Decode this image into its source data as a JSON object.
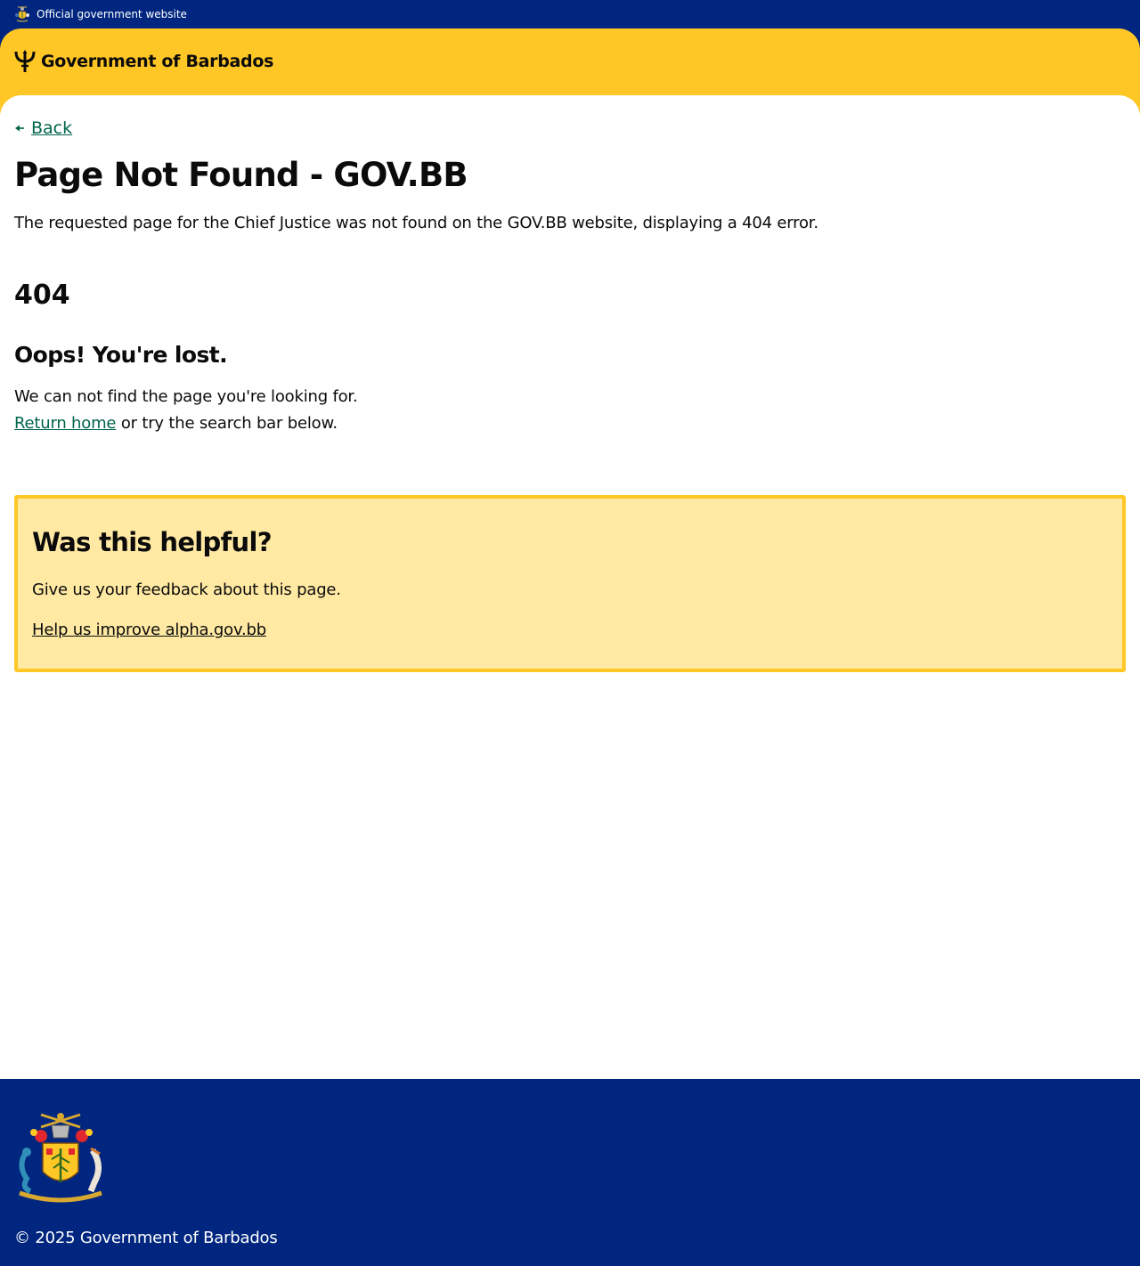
{
  "topbar": {
    "label": "Official government website",
    "crest_icon": "coat-of-arms-icon"
  },
  "header": {
    "brand_name": "Government of Barbados",
    "logo_icon": "trident-icon",
    "accent_color": "#ffc726"
  },
  "main": {
    "back_label": "Back",
    "title": "Page Not Found - GOV.BB",
    "lead": "The requested page for the Chief Justice was not found on the GOV.BB website, displaying a 404 error.",
    "error_code": "404",
    "heading": "Oops! You're lost.",
    "message": "We can not find the page you're looking for.",
    "return_link": "Return home",
    "return_suffix": " or try the search bar below."
  },
  "feedback": {
    "title": "Was this helpful?",
    "text": "Give us your feedback about this page.",
    "link": "Help us improve alpha.gov.bb",
    "background": "#ffe9a3",
    "border": "#ffc726"
  },
  "footer": {
    "copyright": "© 2025 Government of Barbados",
    "emblem_icon": "coat-of-arms-icon",
    "background": "#00267f"
  },
  "colors": {
    "link": "#00654a",
    "navy": "#00267f",
    "text": "#0b0b0b"
  }
}
